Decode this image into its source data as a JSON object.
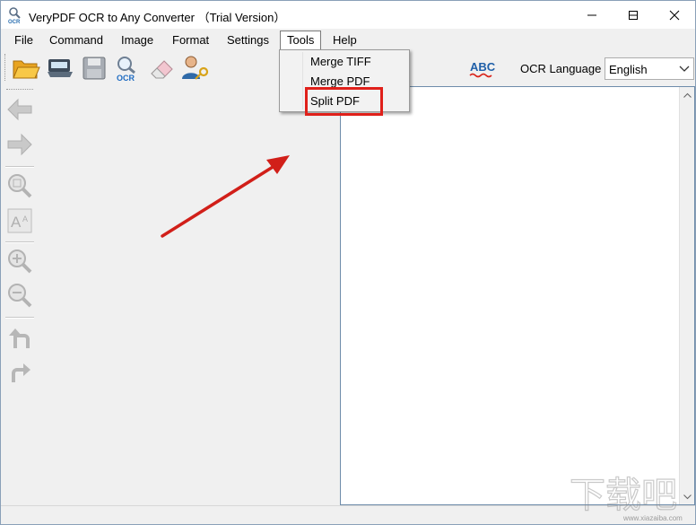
{
  "window": {
    "title": "VeryPDF OCR to Any Converter （Trial Version）"
  },
  "title_controls": {
    "minimize_icon": "minimize-icon",
    "maximize_icon": "maximize-icon",
    "close_icon": "close-icon"
  },
  "menu": {
    "items": [
      {
        "label": "File"
      },
      {
        "label": "Command"
      },
      {
        "label": "Image"
      },
      {
        "label": "Format"
      },
      {
        "label": "Settings"
      },
      {
        "label": "Tools",
        "active": true
      },
      {
        "label": "Help"
      }
    ]
  },
  "tools_menu": {
    "items": [
      {
        "label": "Merge TIFF"
      },
      {
        "label": "Merge PDF"
      },
      {
        "label": "Split PDF",
        "highlighted": true
      }
    ]
  },
  "toolbar": {
    "icons": [
      "open-folder-icon",
      "scanner-icon",
      "save-disk-icon",
      "ocr-magnifier-icon",
      "eraser-icon",
      "user-key-icon"
    ],
    "spellcheck_icon": "abc-spellcheck-icon",
    "ocr_language_label": "OCR Language",
    "ocr_language_value": "English"
  },
  "side_toolbar": {
    "icons": [
      "arrow-left-icon",
      "arrow-right-icon",
      "zoom-fit-icon",
      "text-size-icon",
      "zoom-in-icon",
      "zoom-out-icon",
      "rotate-left-icon",
      "rotate-right-icon"
    ]
  },
  "colors": {
    "annotation_red": "#e0201a",
    "panel_border": "#6e8caa"
  },
  "watermark": {
    "text": "www.xiazaiba.com"
  }
}
